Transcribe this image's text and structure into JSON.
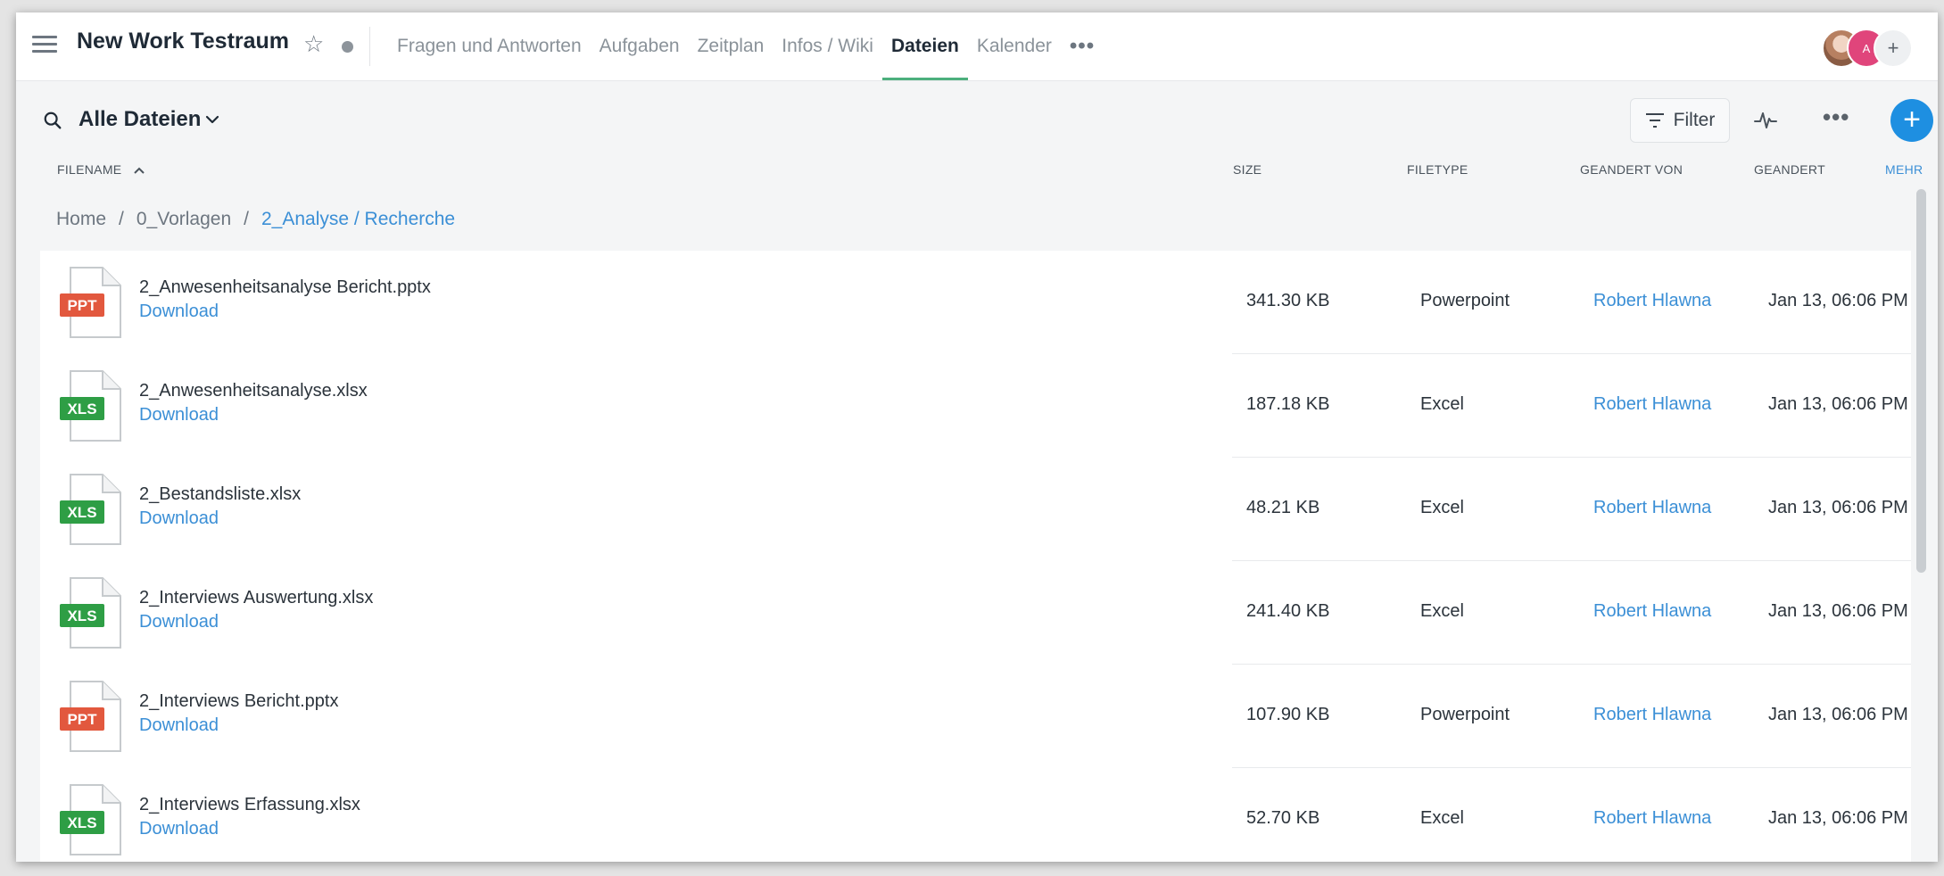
{
  "header": {
    "workspace_title": "New Work Testraum",
    "tabs": [
      {
        "label": "Fragen und Antworten"
      },
      {
        "label": "Aufgaben"
      },
      {
        "label": "Zeitplan"
      },
      {
        "label": "Infos / Wiki"
      },
      {
        "label": "Dateien"
      },
      {
        "label": "Kalender"
      }
    ],
    "more_label": "•••",
    "avatar_letter": "A",
    "add_member_label": "+"
  },
  "toolbar": {
    "view_title": "Alle Dateien",
    "filter_label": "Filter",
    "more_label": "•••",
    "add_label": "+"
  },
  "columns": {
    "filename": "FILENAME",
    "size": "SIZE",
    "filetype": "FILETYPE",
    "changed_by": "GEANDERT VON",
    "changed": "GEANDERT",
    "more": "MEHR"
  },
  "breadcrumb": [
    "Home",
    "0_Vorlagen",
    "2_Analyse / Recherche"
  ],
  "breadcrumb_separator": "/",
  "files": [
    {
      "badge": "PPT",
      "name": "2_Anwesenheitsanalyse Bericht.pptx",
      "download": "Download",
      "size": "341.30 KB",
      "type": "Powerpoint",
      "user": "Robert Hlawna",
      "date": "Jan 13, 06:06 PM"
    },
    {
      "badge": "XLS",
      "name": "2_Anwesenheitsanalyse.xlsx",
      "download": "Download",
      "size": "187.18 KB",
      "type": "Excel",
      "user": "Robert Hlawna",
      "date": "Jan 13, 06:06 PM"
    },
    {
      "badge": "XLS",
      "name": "2_Bestandsliste.xlsx",
      "download": "Download",
      "size": "48.21 KB",
      "type": "Excel",
      "user": "Robert Hlawna",
      "date": "Jan 13, 06:06 PM"
    },
    {
      "badge": "XLS",
      "name": "2_Interviews Auswertung.xlsx",
      "download": "Download",
      "size": "241.40 KB",
      "type": "Excel",
      "user": "Robert Hlawna",
      "date": "Jan 13, 06:06 PM"
    },
    {
      "badge": "PPT",
      "name": "2_Interviews Bericht.pptx",
      "download": "Download",
      "size": "107.90 KB",
      "type": "Powerpoint",
      "user": "Robert Hlawna",
      "date": "Jan 13, 06:06 PM"
    },
    {
      "badge": "XLS",
      "name": "2_Interviews Erfassung.xlsx",
      "download": "Download",
      "size": "52.70 KB",
      "type": "Excel",
      "user": "Robert Hlawna",
      "date": "Jan 13, 06:06 PM"
    }
  ],
  "colors": {
    "accent_blue": "#1e8fe1",
    "link_blue": "#3b8fd6",
    "active_tab_underline": "#4caf7d",
    "ppt_badge": "#e2583e",
    "xls_badge": "#2e9e45"
  }
}
